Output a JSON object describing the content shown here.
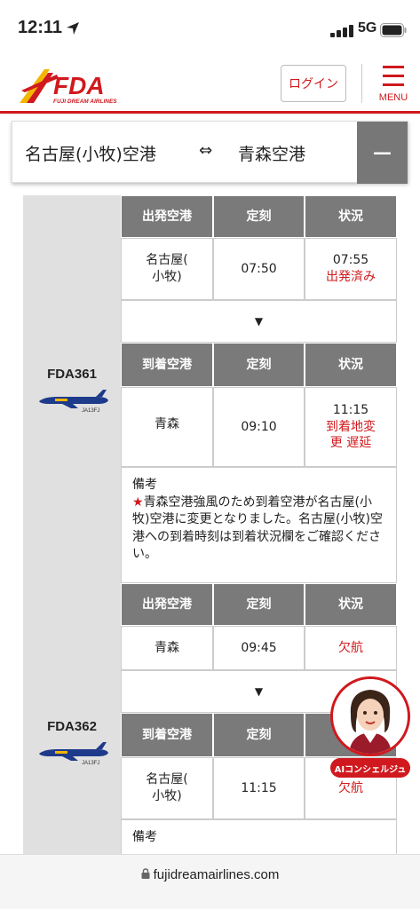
{
  "status_bar": {
    "time": "12:11",
    "network": "5G"
  },
  "header": {
    "logo_text": "FDA",
    "logo_sub": "FUJI DREAM AIRLINES",
    "login_label": "ログイン",
    "menu_label": "MENU"
  },
  "route": {
    "from": "名古屋(小牧)空港",
    "arrow": "⇔",
    "to": "青森空港",
    "collapse_label": "−"
  },
  "columns": {
    "dep_airport": "出発空港",
    "arr_airport": "到着空港",
    "scheduled": "定刻",
    "status": "状況"
  },
  "flights": [
    {
      "flight_no": "FDA361",
      "reg": "JA13FJ",
      "departure": {
        "airport_l1": "名古屋(",
        "airport_l2": "小牧)",
        "time": "07:50",
        "status_time": "07:55",
        "status_text": "出発済み"
      },
      "arrival": {
        "airport": "青森",
        "time": "09:10",
        "status_time": "11:15",
        "status_l1": "到着地変",
        "status_l2": "更 遅延"
      },
      "divider": "▼",
      "remarks_label": "備考",
      "remarks_star": "★",
      "remarks_text": "青森空港強風のため到着空港が名古屋(小牧)空港に変更となりました。名古屋(小牧)空港への到着時刻は到着状況欄をご確認ください。"
    },
    {
      "flight_no": "FDA362",
      "reg": "JA13FJ",
      "departure": {
        "airport": "青森",
        "time": "09:45",
        "status_text": "欠航"
      },
      "arrival": {
        "airport_l1": "名古屋(",
        "airport_l2": "小牧)",
        "time": "11:15",
        "status_text": "欠航"
      },
      "divider": "▼",
      "remarks_label": "備考"
    }
  ],
  "concierge": {
    "label": "AIコンシェルジュ"
  },
  "browser": {
    "url": "fujidreamairlines.com"
  },
  "colors": {
    "brand_red": "#d0191e",
    "header_gray": "#7a7a7a",
    "side_gray": "#e0e0e0"
  }
}
